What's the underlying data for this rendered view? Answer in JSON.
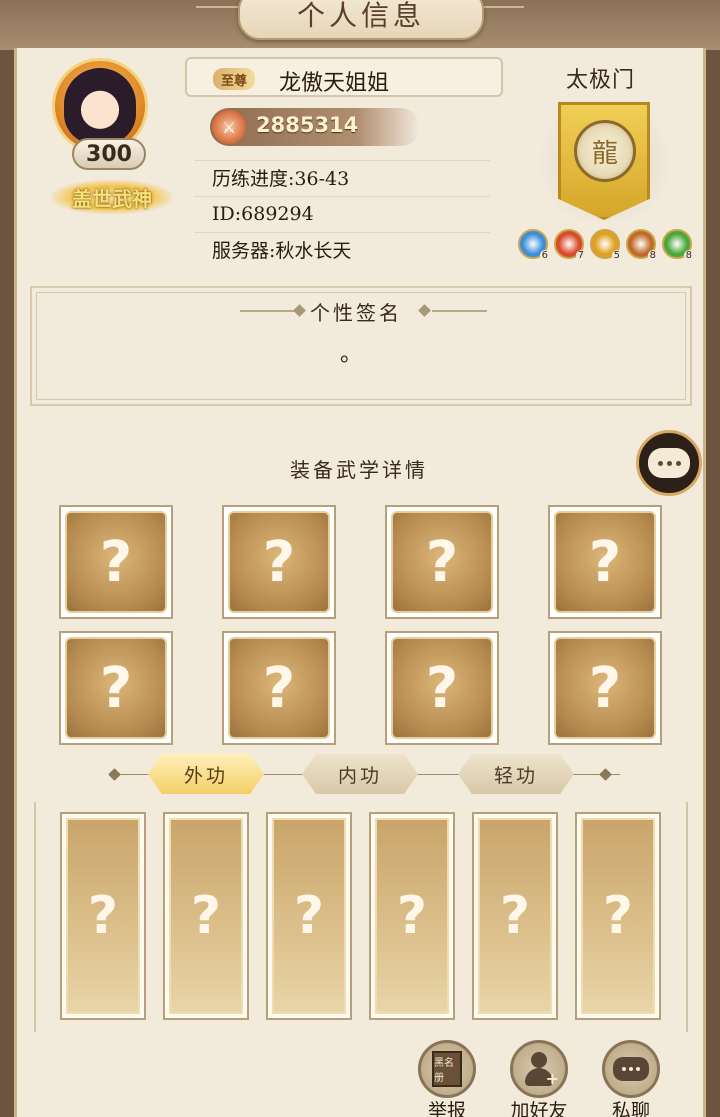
{
  "header": {
    "title": "个人信息"
  },
  "player": {
    "level": "300",
    "title_badge": "盖世武神",
    "vip_tag": "至尊",
    "name": "龙傲天姐姐",
    "power": "2885314",
    "progress_label": "历练进度:36-43",
    "id_label": "ID:689294",
    "server_label": "服务器:秋水长天"
  },
  "sect": {
    "name": "太极门",
    "elements": [
      {
        "icon": "water-element-icon",
        "value": "6",
        "color": "#3a8fd8"
      },
      {
        "icon": "fire-element-icon",
        "value": "7",
        "color": "#d84a2a"
      },
      {
        "icon": "gold-element-icon",
        "value": "5",
        "color": "#e0a020"
      },
      {
        "icon": "earth-element-icon",
        "value": "8",
        "color": "#c06a2a"
      },
      {
        "icon": "wood-element-icon",
        "value": "8",
        "color": "#4aa83a"
      }
    ]
  },
  "signature": {
    "title": "个性签名",
    "content": "。"
  },
  "equipment": {
    "title": "装备武学详情",
    "slots": [
      "?",
      "?",
      "?",
      "?",
      "?",
      "?",
      "?",
      "?"
    ]
  },
  "skill_tabs": [
    {
      "label": "外功",
      "active": true
    },
    {
      "label": "内功",
      "active": false
    },
    {
      "label": "轻功",
      "active": false
    }
  ],
  "skill_cards": [
    "?",
    "?",
    "?",
    "?",
    "?",
    "?"
  ],
  "actions": {
    "report_label": "举报",
    "report_icon_text": "黑名册",
    "add_friend_label": "加好友",
    "private_chat_label": "私聊"
  }
}
